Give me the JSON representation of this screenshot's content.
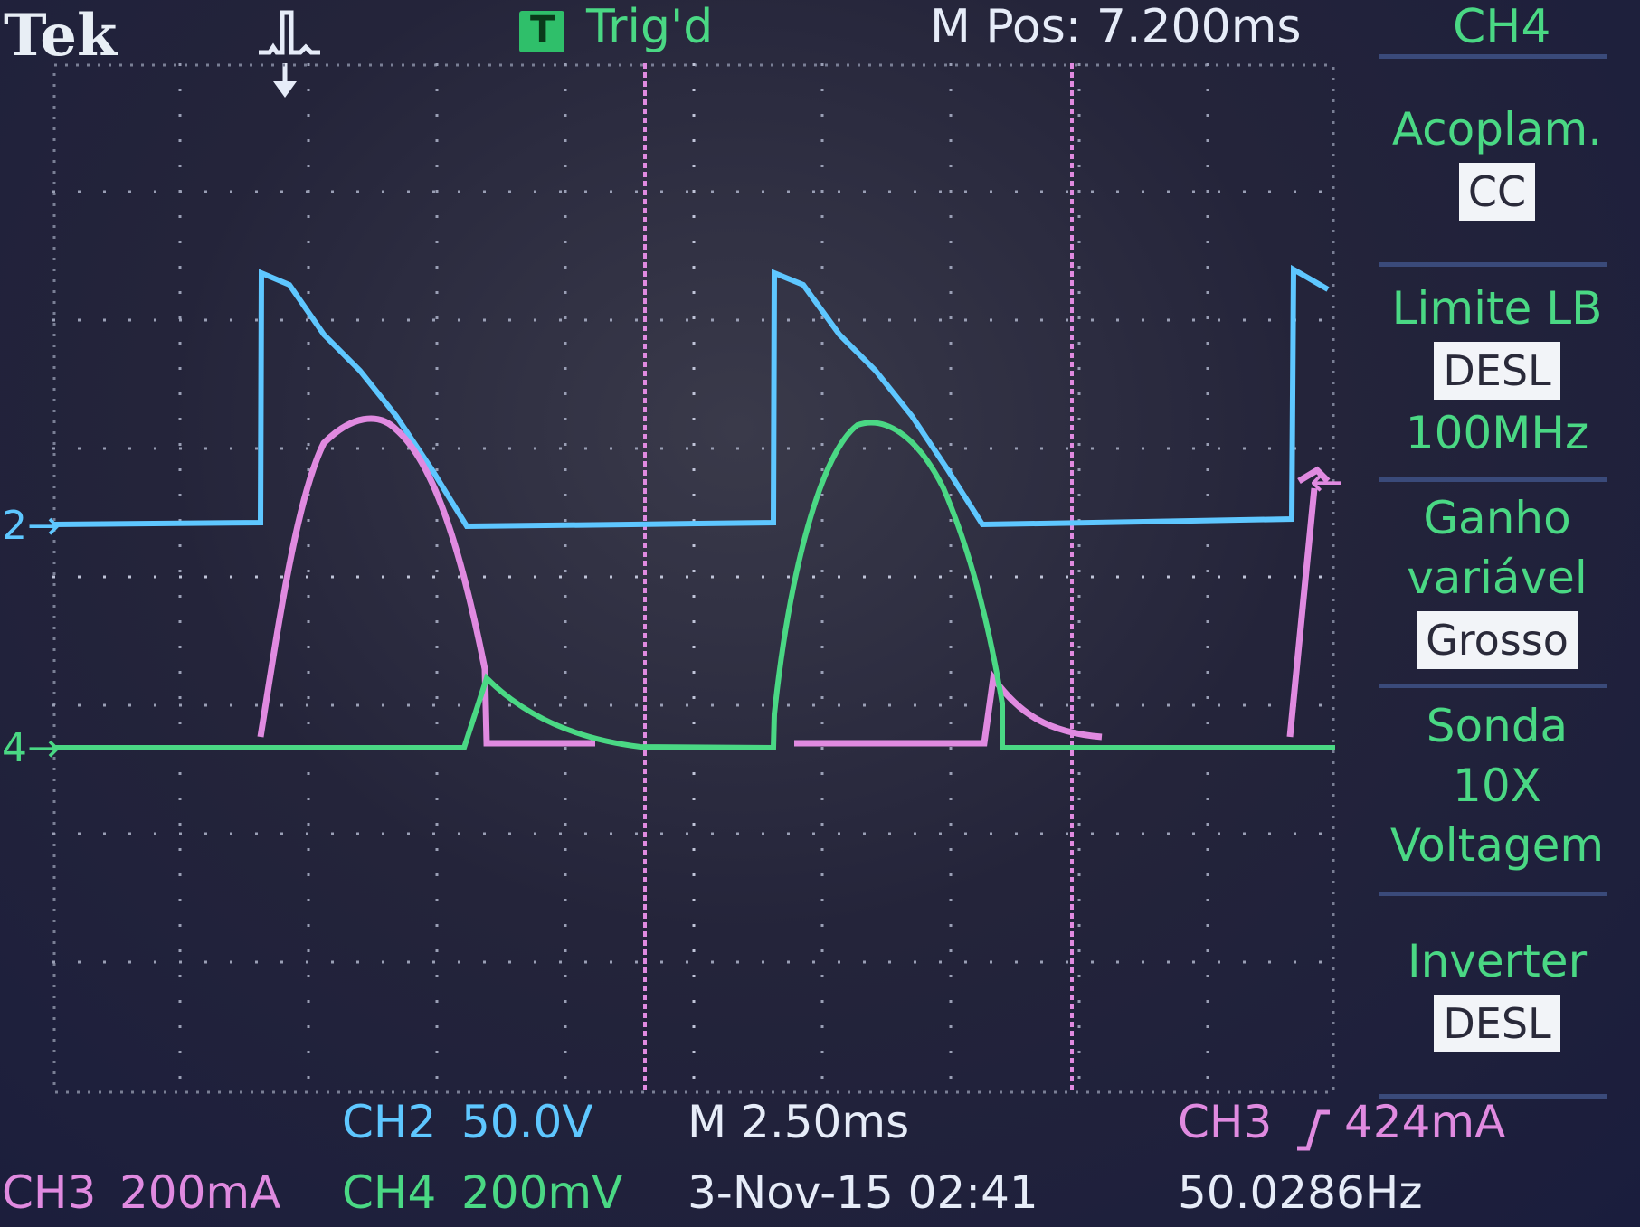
{
  "header": {
    "brand": "Tek",
    "trigger_status": "Trig'd",
    "horizontal_position": "M Pos: 7.200ms",
    "menu_channel": "CH4"
  },
  "side_menu": {
    "coupling": {
      "label": "Acoplam.",
      "value": "CC"
    },
    "bandwidth": {
      "label": "Limite LB",
      "value": "DESL",
      "detail": "100MHz"
    },
    "variable_gain": {
      "label_line1": "Ganho",
      "label_line2": "variável",
      "value": "Grosso"
    },
    "probe": {
      "label": "Sonda",
      "value": "10X",
      "type": "Voltagem"
    },
    "invert": {
      "label": "Inverter",
      "value": "DESL"
    }
  },
  "channel_markers": {
    "ch2": "2",
    "ch4": "4"
  },
  "bottom": {
    "ch2_label": "CH2",
    "ch2_scale": "50.0V",
    "timebase": "M 2.50ms",
    "trigger_source": "CH3",
    "trigger_level": "424mA",
    "ch3_label": "CH3",
    "ch3_scale": "200mA",
    "ch4_label": "CH4",
    "ch4_scale": "200mV",
    "datetime": "3-Nov-15 02:41",
    "frequency": "50.0286Hz"
  },
  "colors": {
    "ch2": "#5ec7ff",
    "ch3": "#e08ae0",
    "ch4": "#4ad884",
    "menu_text": "#4ad884"
  }
}
